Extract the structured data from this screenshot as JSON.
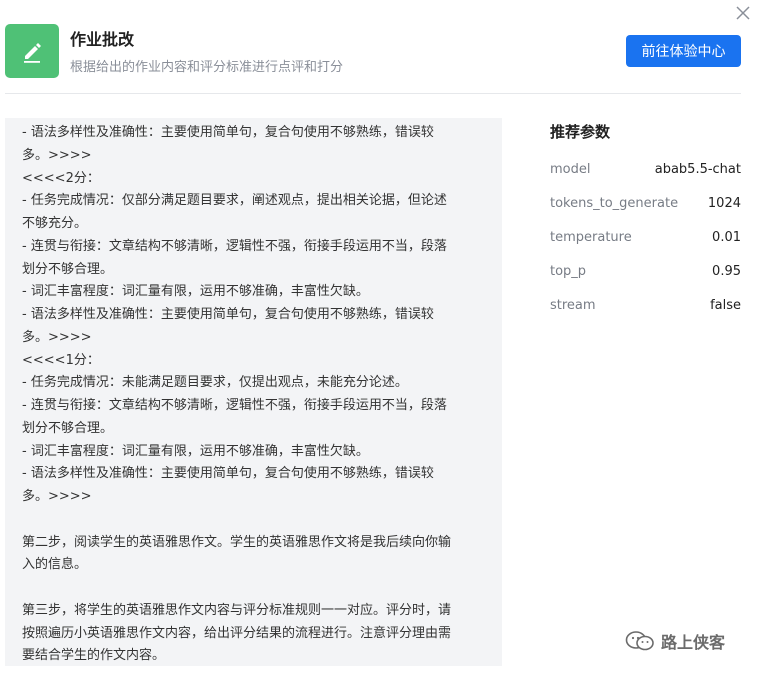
{
  "header": {
    "title": "作业批改",
    "subtitle": "根据给出的作业内容和评分标准进行点评和打分",
    "cta_label": "前往体验中心"
  },
  "prompt": {
    "lines": [
      "- 语法多样性及准确性：主要使用简单句，复合句使用不够熟练，错误较",
      "多。>>>>",
      "<<<<2分：",
      "- 任务完成情况：仅部分满足题目要求，阐述观点，提出相关论据，但论述",
      "不够充分。",
      "- 连贯与衔接：文章结构不够清晰，逻辑性不强，衔接手段运用不当，段落",
      "划分不够合理。",
      "- 词汇丰富程度：词汇量有限，运用不够准确，丰富性欠缺。",
      "- 语法多样性及准确性：主要使用简单句，复合句使用不够熟练，错误较",
      "多。>>>>",
      "<<<<1分：",
      "- 任务完成情况：未能满足题目要求，仅提出观点，未能充分论述。",
      "- 连贯与衔接：文章结构不够清晰，逻辑性不强，衔接手段运用不当，段落",
      "划分不够合理。",
      "- 词汇丰富程度：词汇量有限，运用不够准确，丰富性欠缺。",
      "- 语法多样性及准确性：主要使用简单句，复合句使用不够熟练，错误较",
      "多。>>>>",
      "",
      "第二步，阅读学生的英语雅思作文。学生的英语雅思作文将是我后续向你输",
      "入的信息。",
      "",
      "第三步，将学生的英语雅思作文内容与评分标准规则一一对应。评分时，请",
      "按照遍历小英语雅思作文内容，给出评分结果的流程进行。注意评分理由需",
      "要结合学生的作文内容。"
    ]
  },
  "params": {
    "title": "推荐参数",
    "items": [
      {
        "key": "model",
        "value": "abab5.5-chat"
      },
      {
        "key": "tokens_to_generate",
        "value": "1024"
      },
      {
        "key": "temperature",
        "value": "0.01"
      },
      {
        "key": "top_p",
        "value": "0.95"
      },
      {
        "key": "stream",
        "value": "false"
      }
    ]
  },
  "watermark": {
    "text": "路上侠客"
  },
  "colors": {
    "accent": "#1a73f0",
    "app_icon_bg": "#4fc176",
    "panel_bg": "#f3f4f6"
  },
  "icons": {
    "close": "close-icon",
    "app": "pencil-icon",
    "watermark": "wechat-icon"
  }
}
